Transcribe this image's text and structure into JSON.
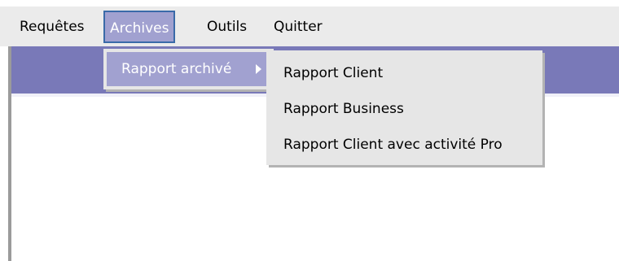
{
  "menubar": {
    "items": [
      {
        "label": "Requêtes"
      },
      {
        "label": "Archives"
      },
      {
        "label": "Outils"
      },
      {
        "label": "Quitter"
      }
    ]
  },
  "archives_menu": {
    "items": [
      {
        "label": "Rapport archivé",
        "has_submenu": true,
        "submenu_icon": "chevron-right-icon"
      }
    ]
  },
  "rapport_submenu": {
    "items": [
      {
        "label": "Rapport Client"
      },
      {
        "label": "Rapport Business"
      },
      {
        "label": "Rapport Client avec activité Pro"
      }
    ]
  },
  "colors": {
    "menubar_bg": "#ebebeb",
    "highlight": "#a1a1d0",
    "highlight_border": "#3a6aa8",
    "band": "#7979b8",
    "menu_bg": "#e6e6e6"
  }
}
